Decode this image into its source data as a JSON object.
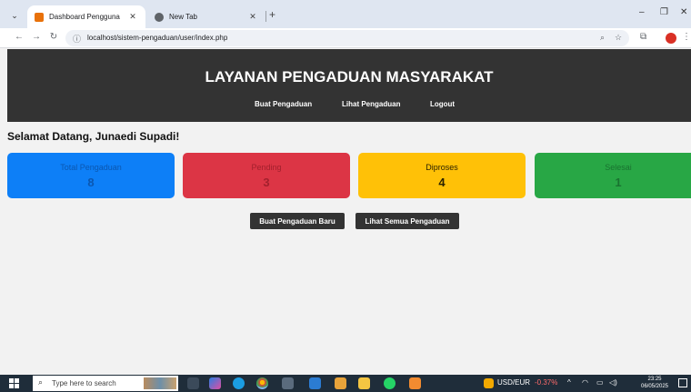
{
  "browser": {
    "tabs": [
      {
        "title": "Dashboard Pengguna",
        "active": true
      },
      {
        "title": "New Tab",
        "active": false
      }
    ],
    "url": "localhost/sistem-pengaduan/user/index.php"
  },
  "site": {
    "title": "LAYANAN PENGADUAN MASYARAKAT",
    "nav": [
      "Buat Pengaduan",
      "Lihat Pengaduan",
      "Logout"
    ]
  },
  "welcome": "Selamat Datang, Junaedi Supadi!",
  "stats": [
    {
      "label": "Total Pengaduan",
      "count": "8",
      "color": "#0d7ff7"
    },
    {
      "label": "Pending",
      "count": "3",
      "color": "#dc3545"
    },
    {
      "label": "Diproses",
      "count": "4",
      "color": "#ffc107"
    },
    {
      "label": "Selesai",
      "count": "1",
      "color": "#28a745"
    }
  ],
  "actions": [
    "Buat Pengaduan Baru",
    "Lihat Semua Pengaduan"
  ],
  "taskbar": {
    "search_placeholder": "Type here to search",
    "currency": "USD/EUR",
    "currency_change": "-0.37%",
    "time": "23:25",
    "date": "06/05/2025"
  }
}
